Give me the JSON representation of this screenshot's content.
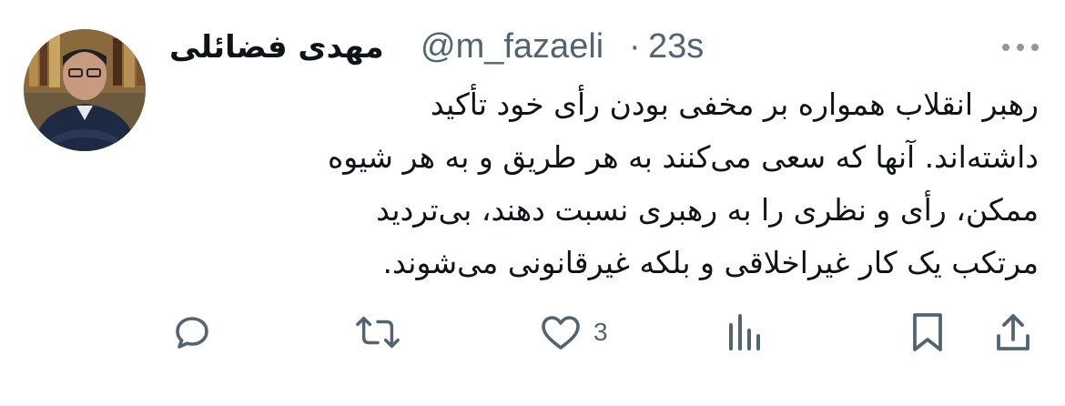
{
  "tweet": {
    "author_name": "مهدی فضائلی",
    "handle": "@m_fazaeli",
    "separator": "·",
    "time": "23s",
    "more_icon": "more-horizontal-icon",
    "text_lines": [
      "رهبر انقلاب همواره بر مخفی بودن رأی خود تأکید",
      "داشته‌اند. آنها که سعی می‌کنند به هر طریق و به هر شیوه",
      "ممکن، رأی و نظری را به رهبری نسبت دهند، بی‌تردید",
      "مرتکب یک کار غیراخلاقی و بلکه غیرقانونی می‌شوند."
    ]
  },
  "actions": {
    "reply_icon": "reply-icon",
    "retweet_icon": "retweet-icon",
    "like_icon": "heart-icon",
    "like_count": "3",
    "views_icon": "views-icon",
    "bookmark_icon": "bookmark-icon",
    "share_icon": "share-icon"
  },
  "colors": {
    "text": "#0f1419",
    "secondary": "#536471",
    "icon": "#536471",
    "background": "#ffffff"
  }
}
